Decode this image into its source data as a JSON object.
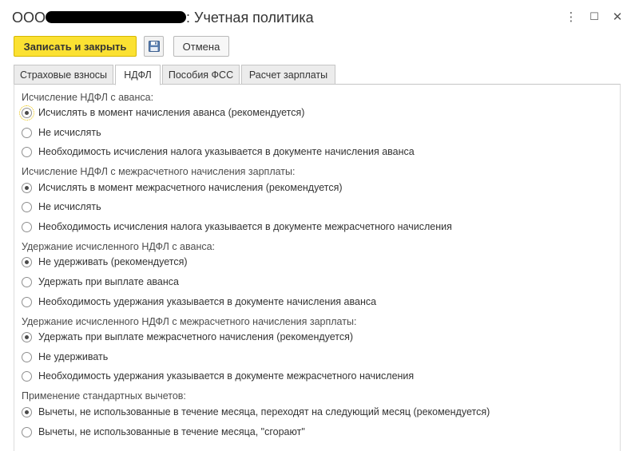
{
  "window": {
    "title_prefix": "ООО",
    "title_suffix": ": Учетная политика",
    "more_icon": "⋮",
    "maximize_icon": "☐",
    "close_icon": "✕"
  },
  "toolbar": {
    "save_close_label": "Записать и закрыть",
    "cancel_label": "Отмена"
  },
  "tabs": [
    {
      "label": "Страховые взносы"
    },
    {
      "label": "НДФЛ"
    },
    {
      "label": "Пособия ФСС"
    },
    {
      "label": "Расчет зарплаты"
    }
  ],
  "groups": [
    {
      "label": "Исчисление НДФЛ с аванса:",
      "options": [
        {
          "label": "Исчислять в момент начисления аванса (рекомендуется)",
          "selected": true
        },
        {
          "label": "Не исчислять",
          "selected": false
        },
        {
          "label": "Необходимость исчисления налога указывается в документе начисления аванса",
          "selected": false
        }
      ]
    },
    {
      "label": "Исчисление НДФЛ с межрасчетного начисления зарплаты:",
      "options": [
        {
          "label": "Исчислять в момент межрасчетного начисления (рекомендуется)",
          "selected": true
        },
        {
          "label": "Не исчислять",
          "selected": false
        },
        {
          "label": "Необходимость исчисления налога указывается в документе межрасчетного начисления",
          "selected": false
        }
      ]
    },
    {
      "label": "Удержание исчисленного НДФЛ с аванса:",
      "options": [
        {
          "label": "Не удерживать (рекомендуется)",
          "selected": true
        },
        {
          "label": "Удержать при выплате аванса",
          "selected": false
        },
        {
          "label": "Необходимость удержания указывается в документе начисления аванса",
          "selected": false
        }
      ]
    },
    {
      "label": "Удержание исчисленного НДФЛ с межрасчетного начисления зарплаты:",
      "options": [
        {
          "label": "Удержать при выплате межрасчетного начисления (рекомендуется)",
          "selected": true
        },
        {
          "label": "Не удерживать",
          "selected": false
        },
        {
          "label": "Необходимость удержания указывается в документе межрасчетного начисления",
          "selected": false
        }
      ]
    },
    {
      "label": "Применение стандартных вычетов:",
      "options": [
        {
          "label": "Вычеты, не использованные в течение месяца, переходят на следующий месяц (рекомендуется)",
          "selected": true
        },
        {
          "label": "Вычеты, не использованные в течение месяца, \"сгорают\"",
          "selected": false
        }
      ]
    }
  ]
}
